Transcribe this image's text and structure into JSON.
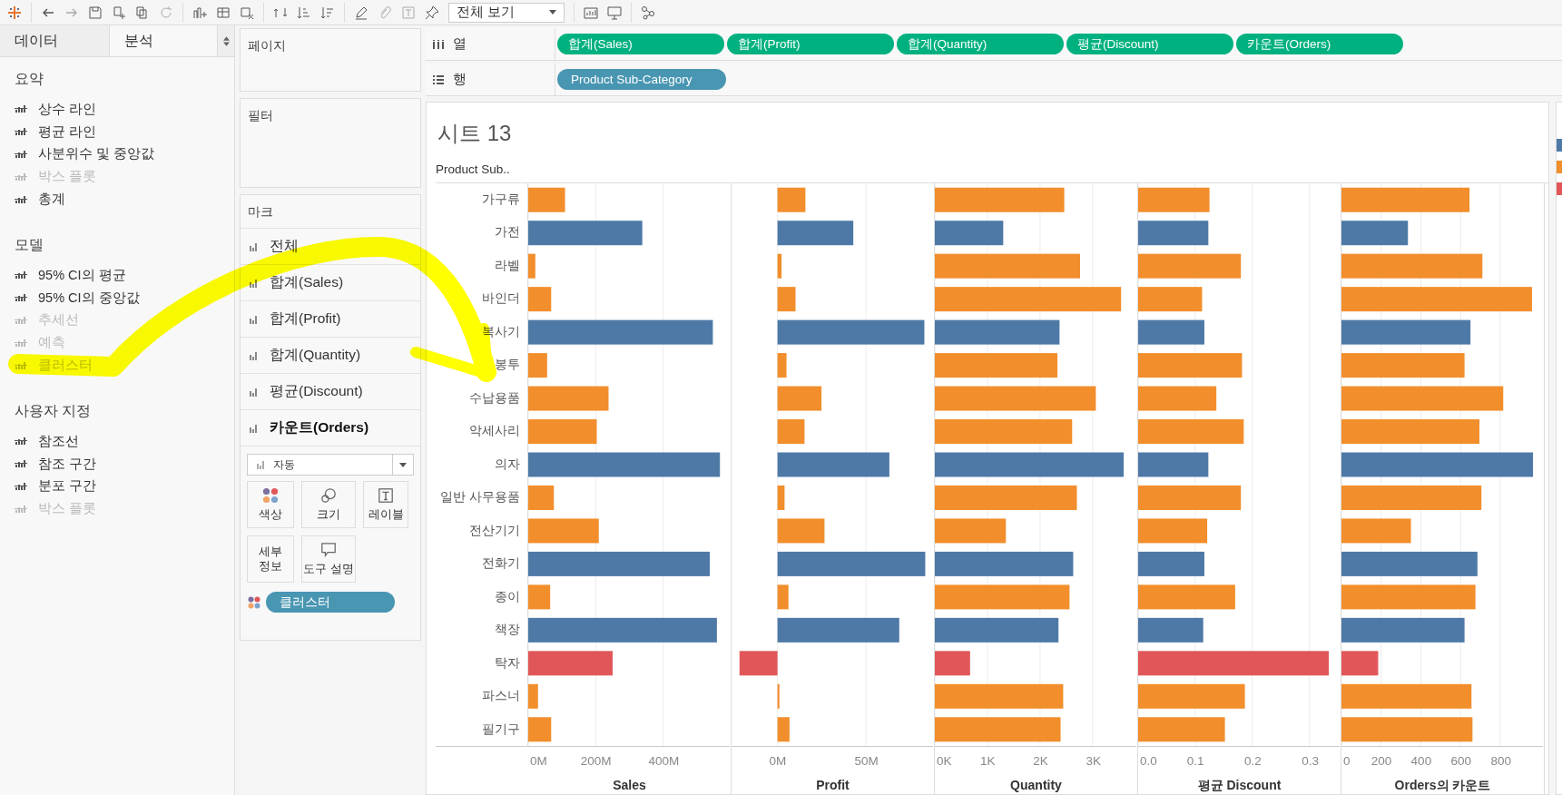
{
  "toolbar": {
    "view_dropdown": "전체 보기"
  },
  "side_tabs": [
    {
      "label": "데이터",
      "selected": false
    },
    {
      "label": "분석",
      "selected": true
    }
  ],
  "analytics": [
    {
      "title": "요약",
      "items": [
        {
          "label": "상수 라인",
          "disabled": false
        },
        {
          "label": "평균 라인",
          "disabled": false
        },
        {
          "label": "사분위수 및 중앙값",
          "disabled": false
        },
        {
          "label": "박스 플롯",
          "disabled": true
        },
        {
          "label": "총계",
          "disabled": false
        }
      ]
    },
    {
      "title": "모델",
      "items": [
        {
          "label": "95% CI의 평균",
          "disabled": false
        },
        {
          "label": "95% CI의 중앙값",
          "disabled": false
        },
        {
          "label": "추세선",
          "disabled": true
        },
        {
          "label": "예측",
          "disabled": true
        },
        {
          "label": "클러스터",
          "disabled": true
        }
      ]
    },
    {
      "title": "사용자 지정",
      "items": [
        {
          "label": "참조선",
          "disabled": false
        },
        {
          "label": "참조 구간",
          "disabled": false
        },
        {
          "label": "분포 구간",
          "disabled": false
        },
        {
          "label": "박스 플롯",
          "disabled": true
        }
      ]
    }
  ],
  "pages_card": {
    "title": "페이지"
  },
  "filters_card": {
    "title": "필터"
  },
  "marks_card": {
    "title": "마크",
    "items": [
      {
        "label": "전체",
        "selected": false
      },
      {
        "label": "합계(Sales)",
        "selected": false
      },
      {
        "label": "합계(Profit)",
        "selected": false
      },
      {
        "label": "합계(Quantity)",
        "selected": false
      },
      {
        "label": "평균(Discount)",
        "selected": false
      },
      {
        "label": "카운트(Orders)",
        "selected": true
      }
    ],
    "mark_type": "자동",
    "buttons": [
      {
        "kind": "color",
        "label": "색상"
      },
      {
        "kind": "size",
        "label": "크기"
      },
      {
        "kind": "label",
        "label": "레이블"
      },
      {
        "kind": "detail",
        "label": "세부 정보"
      },
      {
        "kind": "tooltip",
        "label": "도구 설명"
      }
    ],
    "pill": "클러스터"
  },
  "columns_shelf": {
    "label": "열",
    "pills": [
      "합계(Sales)",
      "합계(Profit)",
      "합계(Quantity)",
      "평균(Discount)",
      "카운트(Orders)"
    ]
  },
  "rows_shelf": {
    "label": "행",
    "pills": [
      "Product Sub-Category"
    ]
  },
  "sheet": {
    "title": "시트 13",
    "row_header": "Product Sub..",
    "panels": [
      {
        "chart_data": {
          "type": "bar",
          "orientation": "horizontal",
          "grid": true,
          "xlabel": "Sales",
          "categories": [
            "가구류",
            "가전",
            "라벨",
            "바인더",
            "복사기",
            "봉투",
            "수납용품",
            "악세사리",
            "의자",
            "일반 사무용품",
            "전산기기",
            "전화기",
            "종이",
            "책장",
            "탁자",
            "파스너",
            "필기구"
          ],
          "xlim": [
            0,
            597
          ],
          "xticks": [
            {
              "value": 0,
              "label": "0M"
            },
            {
              "value": 200,
              "label": "200M"
            },
            {
              "value": 400,
              "label": "400M"
            }
          ],
          "series": [
            {
              "color": "#4e79a7",
              "values": [
                null,
                338,
                null,
                null,
                547,
                null,
                null,
                null,
                568,
                null,
                null,
                538,
                null,
                559,
                null,
                null,
                null
              ]
            },
            {
              "color": "#f28e2b",
              "values": [
                109,
                null,
                21,
                68,
                null,
                56,
                238,
                203,
                null,
                76,
                209,
                null,
                65,
                null,
                null,
                29,
                68
              ]
            },
            {
              "color": "#e15759",
              "values": [
                null,
                null,
                null,
                null,
                null,
                null,
                null,
                null,
                null,
                null,
                null,
                null,
                null,
                null,
                250,
                null,
                null
              ]
            }
          ]
        }
      },
      {
        "chart_data": {
          "type": "bar",
          "orientation": "horizontal",
          "grid": true,
          "xlabel": "Profit",
          "xlim": [
            -26,
            88
          ],
          "xticks": [
            {
              "value": 0,
              "label": "0M"
            },
            {
              "value": 50,
              "label": "50M"
            }
          ],
          "series": [
            {
              "color": "#4e79a7",
              "values": [
                null,
                42.9,
                null,
                null,
                83.1,
                null,
                null,
                null,
                63.3,
                null,
                null,
                83.6,
                null,
                68.9,
                null,
                null,
                null
              ]
            },
            {
              "color": "#f28e2b",
              "values": [
                15.8,
                null,
                2.3,
                10.2,
                null,
                5.1,
                24.9,
                15.3,
                null,
                4.0,
                26.6,
                null,
                6.2,
                null,
                null,
                1.1,
                6.8
              ]
            },
            {
              "color": "#e15759",
              "values": [
                null,
                null,
                null,
                null,
                null,
                null,
                null,
                null,
                null,
                null,
                null,
                null,
                null,
                null,
                -21.5,
                null,
                null
              ]
            }
          ]
        }
      },
      {
        "chart_data": {
          "type": "bar",
          "orientation": "horizontal",
          "grid": true,
          "xlabel": "Quantity",
          "xlim": [
            0,
            3830
          ],
          "xticks": [
            {
              "value": 0,
              "label": "0K"
            },
            {
              "value": 1000,
              "label": "1K"
            },
            {
              "value": 2000,
              "label": "2K"
            },
            {
              "value": 3000,
              "label": "3K"
            }
          ],
          "series": [
            {
              "color": "#4e79a7",
              "values": [
                null,
                1300,
                null,
                null,
                2370,
                null,
                null,
                null,
                3590,
                null,
                null,
                2630,
                null,
                2350,
                null,
                null,
                null
              ]
            },
            {
              "color": "#f28e2b",
              "values": [
                2460,
                null,
                2760,
                3540,
                null,
                2330,
                3060,
                2610,
                null,
                2700,
                1350,
                null,
                2560,
                null,
                null,
                2440,
                2390
              ]
            },
            {
              "color": "#e15759",
              "values": [
                null,
                null,
                null,
                null,
                null,
                null,
                null,
                null,
                null,
                null,
                null,
                null,
                null,
                null,
                670,
                null,
                null
              ]
            }
          ]
        }
      },
      {
        "chart_data": {
          "type": "bar",
          "orientation": "horizontal",
          "grid": true,
          "xlabel": "평균 Discount",
          "xlim": [
            0,
            0.353
          ],
          "xticks": [
            {
              "value": 0,
              "label": "0.0"
            },
            {
              "value": 0.1,
              "label": "0.1"
            },
            {
              "value": 0.2,
              "label": "0.2"
            },
            {
              "value": 0.3,
              "label": "0.3"
            }
          ],
          "series": [
            {
              "color": "#4e79a7",
              "values": [
                null,
                0.123,
                null,
                null,
                0.116,
                null,
                null,
                null,
                0.123,
                null,
                null,
                0.116,
                null,
                0.114,
                null,
                null,
                null
              ]
            },
            {
              "color": "#f28e2b",
              "values": [
                0.125,
                null,
                0.18,
                0.112,
                null,
                0.182,
                0.137,
                0.185,
                null,
                0.18,
                0.121,
                null,
                0.17,
                null,
                null,
                0.187,
                0.152
              ]
            },
            {
              "color": "#e15759",
              "values": [
                null,
                null,
                null,
                null,
                null,
                null,
                null,
                null,
                null,
                null,
                null,
                null,
                null,
                null,
                0.334,
                null,
                null
              ]
            }
          ]
        }
      },
      {
        "chart_data": {
          "type": "bar",
          "orientation": "horizontal",
          "grid": true,
          "xlabel": "Orders의 카운트",
          "xlim": [
            0,
            1015
          ],
          "xticks": [
            {
              "value": 0,
              "label": "0"
            },
            {
              "value": 200,
              "label": "200"
            },
            {
              "value": 400,
              "label": "400"
            },
            {
              "value": 600,
              "label": "600"
            },
            {
              "value": 800,
              "label": "800"
            }
          ],
          "series": [
            {
              "color": "#4e79a7",
              "values": [
                null,
                335,
                null,
                null,
                650,
                null,
                null,
                null,
                965,
                null,
                null,
                685,
                null,
                620,
                null,
                null,
                null
              ]
            },
            {
              "color": "#f28e2b",
              "values": [
                645,
                null,
                710,
                960,
                null,
                620,
                815,
                695,
                null,
                705,
                350,
                null,
                675,
                null,
                null,
                655,
                660
              ]
            },
            {
              "color": "#e15759",
              "values": [
                null,
                null,
                null,
                null,
                null,
                null,
                null,
                null,
                null,
                null,
                null,
                null,
                null,
                null,
                185,
                null,
                null
              ]
            }
          ]
        }
      }
    ]
  },
  "legend": [
    {
      "color": "#4e79a7"
    },
    {
      "color": "#f28e2b"
    },
    {
      "color": "#e15759"
    }
  ]
}
